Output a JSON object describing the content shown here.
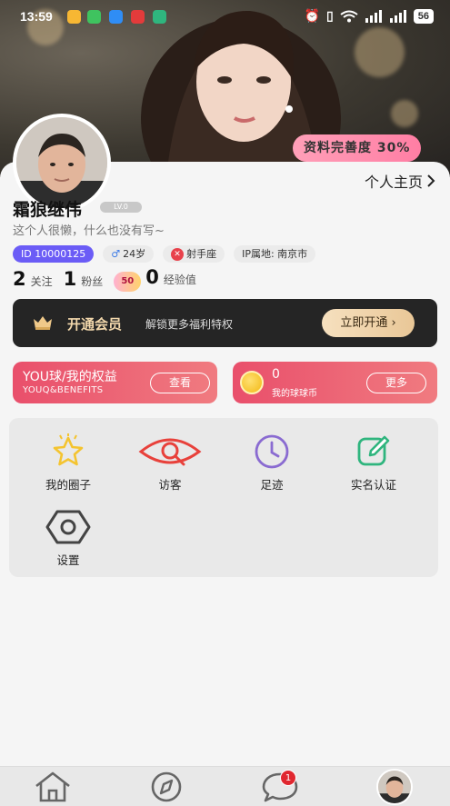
{
  "status_bar": {
    "time": "13:59",
    "battery": "56",
    "left_icons": [
      "weibo-icon",
      "wechat-icon",
      "browser-icon",
      "xiaohongshu-icon",
      "app-icon"
    ],
    "right_icons": [
      "alarm-icon",
      "vibrate-icon",
      "wifi-icon",
      "signal-icon",
      "signal-icon",
      "battery-icon"
    ]
  },
  "profile": {
    "completeness_label": "资料完善度 30%",
    "homepage_link": "个人主页",
    "name": "霜狼继伟",
    "level_pill": "LV.0",
    "bio": "这个人很懒，什么也没有写~",
    "tags": {
      "id": "ID 10000125",
      "age": "24岁",
      "zodiac": "射手座",
      "ip": "IP属地: 南京市"
    },
    "stats": [
      {
        "num": "2",
        "label": "关注"
      },
      {
        "num": "1",
        "label": "粉丝"
      },
      {
        "num": "0",
        "label": "经验值",
        "badge": "50"
      }
    ]
  },
  "vip": {
    "title": "开通会员",
    "subtitle": "解锁更多福利特权",
    "button": "立即开通"
  },
  "cards": {
    "benefits": {
      "title": "YOU球/我的权益",
      "subtitle": "YOUQ&BENEFITS",
      "button": "查看"
    },
    "coins": {
      "value": "0",
      "label": "我的球球币",
      "button": "更多"
    }
  },
  "grid": [
    {
      "label": "我的圈子",
      "icon": "star-icon"
    },
    {
      "label": "访客",
      "icon": "eye-icon"
    },
    {
      "label": "足迹",
      "icon": "clock-icon"
    },
    {
      "label": "实名认证",
      "icon": "edit-icon"
    },
    {
      "label": "设置",
      "icon": "settings-icon"
    }
  ],
  "tabbar": {
    "message_badge": "1",
    "tabs": [
      "home-icon",
      "discover-icon",
      "message-icon",
      "profile-avatar"
    ]
  },
  "colors": {
    "accent_red": "#e94f6b",
    "id_purple": "#6b5cf6",
    "vip_gold": "#f3d8ac",
    "badge_pink": "#ff7ea4"
  }
}
